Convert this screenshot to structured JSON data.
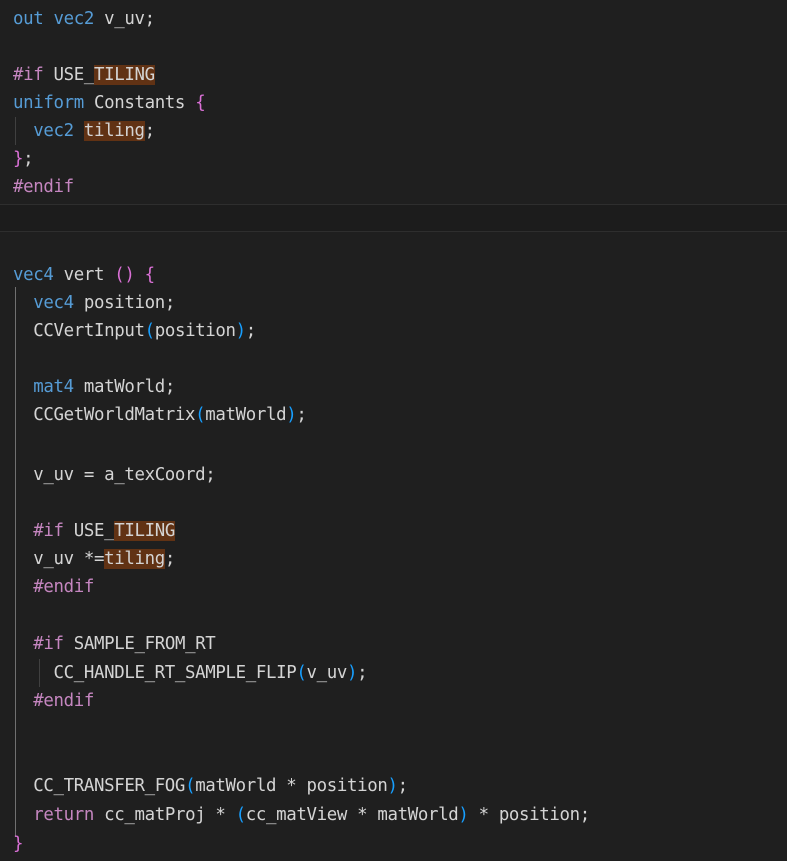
{
  "code": {
    "l1": {
      "kw": "out",
      "ty": "vec2",
      "rest": "v_uv;"
    },
    "l3": {
      "pp": "#if",
      "a": "USE_",
      "hl": "TILING"
    },
    "l4": {
      "kw": "uniform",
      "name": "Constants",
      "brace": "{"
    },
    "l5": {
      "ty": "vec2",
      "hl": "tiling",
      "semi": ";"
    },
    "l6": {
      "brace": "}",
      "semi": ";"
    },
    "l7": {
      "pp": "#endif"
    },
    "l9": {
      "ty": "vec4",
      "name": "vert",
      "parens": "()",
      "brace": "{"
    },
    "l10": {
      "ty": "vec4",
      "rest": "position;"
    },
    "l11": {
      "fn": "CCVertInput",
      "open": "(",
      "arg": "position",
      "close": ")",
      "semi": ";"
    },
    "l13": {
      "ty": "mat4",
      "rest": "matWorld;"
    },
    "l14": {
      "fn": "CCGetWorldMatrix",
      "open": "(",
      "arg": "matWorld",
      "close": ")",
      "semi": ";"
    },
    "l16": {
      "text": "v_uv = a_texCoord;"
    },
    "l18": {
      "pp": "#if",
      "a": "USE_",
      "hl": "TILING"
    },
    "l19": {
      "a": "v_uv *=",
      "hl": "tiling",
      "semi": ";"
    },
    "l20": {
      "pp": "#endif"
    },
    "l22": {
      "pp": "#if",
      "a": "SAMPLE_FROM_RT"
    },
    "l23": {
      "fn": "CC_HANDLE_RT_SAMPLE_FLIP",
      "open": "(",
      "arg": "v_uv",
      "close": ")",
      "semi": ";"
    },
    "l24": {
      "pp": "#endif"
    },
    "l27": {
      "fn": "CC_TRANSFER_FOG",
      "open": "(",
      "arg": "matWorld * position",
      "close": ")",
      "semi": ";"
    },
    "l28": {
      "pp": "return",
      "a": "cc_matProj * ",
      "open": "(",
      "arg": "cc_matView * matWorld",
      "close": ")",
      "b": " * position;"
    },
    "l29": {
      "brace": "}"
    }
  }
}
